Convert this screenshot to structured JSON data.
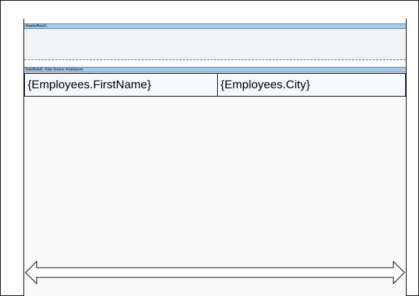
{
  "designer": {
    "header_band": {
      "caption": "HeaderBand1"
    },
    "data_band": {
      "caption": "DataBand1, Data Source: Employees",
      "cells": [
        {
          "text": "{Employees.FirstName}"
        },
        {
          "text": "{Employees.City}"
        }
      ]
    }
  }
}
